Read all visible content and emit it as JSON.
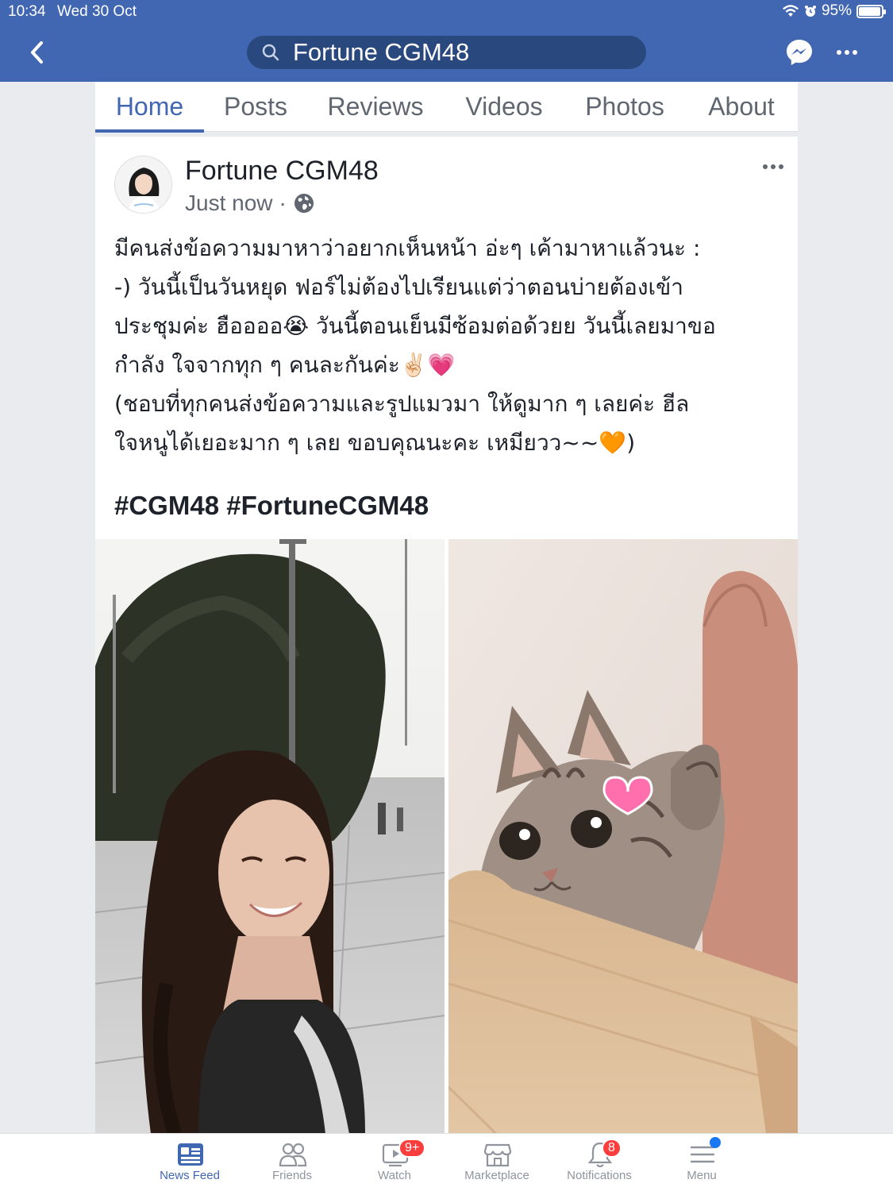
{
  "status_bar": {
    "time": "10:34",
    "date": "Wed 30 Oct",
    "battery": "95%",
    "battery_level": 0.95
  },
  "header": {
    "search_text": "Fortune CGM48"
  },
  "tabs": [
    {
      "label": "Home",
      "active": true
    },
    {
      "label": "Posts"
    },
    {
      "label": "Reviews"
    },
    {
      "label": "Videos"
    },
    {
      "label": "Photos"
    },
    {
      "label": "About"
    }
  ],
  "post": {
    "author": "Fortune CGM48",
    "time": "Just now",
    "separator": "·",
    "body": "มีคนส่งข้อความมาหาว่าอยากเห็นหน้า อ่ะๆ เค้ามาหาแล้วนะ :\n-) วันนี้เป็นวันหยุด ฟอร์ไม่ต้องไปเรียนแต่ว่าตอนบ่ายต้องเข้า\nประชุมค่ะ ฮืออออ😭 วันนี้ตอนเย็นมีซ้อมต่อด้วยย วันนี้เลยมาขอ\nกำลัง ใจจากทุก ๆ คนละกันค่ะ✌🏻💗\n(ชอบที่ทุกคนส่งข้อความและรูปแมวมา ให้ดูมาก ๆ เลยค่ะ ฮีล\nใจหนูได้เยอะมาก ๆ เลย ขอบคุณนะคะ เหมียวว~~🧡)",
    "hashtags": [
      "#CGM48",
      "#FortuneCGM48"
    ]
  },
  "bottom_nav": [
    {
      "label": "News Feed",
      "icon": "news-feed-icon",
      "active": true
    },
    {
      "label": "Friends",
      "icon": "friends-icon"
    },
    {
      "label": "Watch",
      "icon": "watch-icon",
      "badge": "9+"
    },
    {
      "label": "Marketplace",
      "icon": "marketplace-icon"
    },
    {
      "label": "Notifications",
      "icon": "bell-icon",
      "badge": "8"
    },
    {
      "label": "Menu",
      "icon": "menu-icon"
    }
  ],
  "colors": {
    "brand": "#4267b2",
    "badge": "#fa3e3e",
    "text": "#1d2129",
    "muted": "#606770"
  }
}
